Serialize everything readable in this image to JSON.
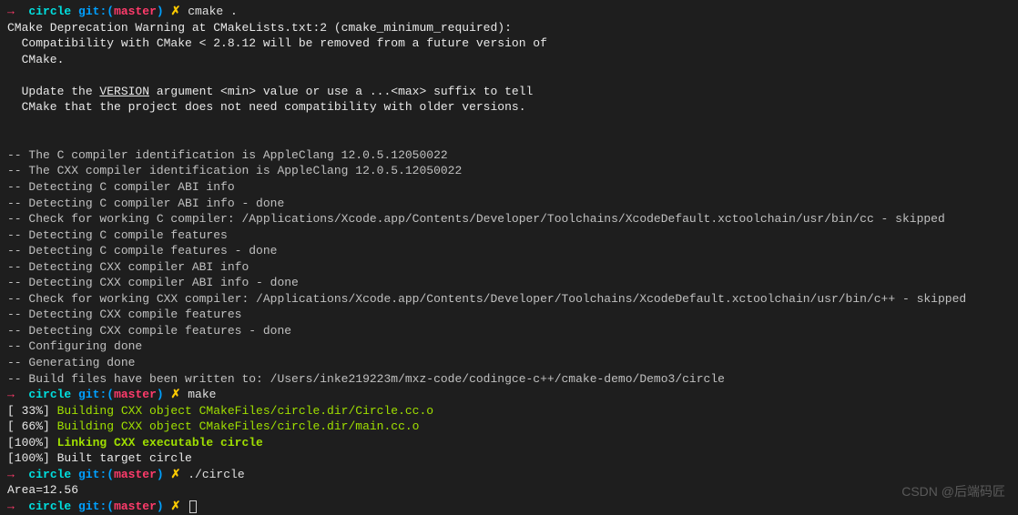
{
  "prompt": {
    "arrow": "→",
    "dir": "circle",
    "git_label": "git:(",
    "branch": "master",
    "close_paren": ")",
    "cross": "✗"
  },
  "commands": {
    "cmake": "cmake .",
    "make": "make",
    "run": "./circle",
    "empty": ""
  },
  "output": {
    "dep_warn_l1": "CMake Deprecation Warning at CMakeLists.txt:2 (cmake_minimum_required):",
    "dep_warn_l2": "  Compatibility with CMake < 2.8.12 will be removed from a future version of",
    "dep_warn_l3": "  CMake.",
    "dep_warn_l4": "  Update the ",
    "dep_warn_version": "VERSION",
    "dep_warn_l4b": " argument <min> value or use a ...<max> suffix to tell",
    "dep_warn_l5": "  CMake that the project does not need compatibility with older versions.",
    "blank": "",
    "c_id": "-- The C compiler identification is AppleClang 12.0.5.12050022",
    "cxx_id": "-- The CXX compiler identification is AppleClang 12.0.5.12050022",
    "det_c_abi": "-- Detecting C compiler ABI info",
    "det_c_abi_done": "-- Detecting C compiler ABI info - done",
    "check_c": "-- Check for working C compiler: /Applications/Xcode.app/Contents/Developer/Toolchains/XcodeDefault.xctoolchain/usr/bin/cc - skipped",
    "det_c_feat": "-- Detecting C compile features",
    "det_c_feat_done": "-- Detecting C compile features - done",
    "det_cxx_abi": "-- Detecting CXX compiler ABI info",
    "det_cxx_abi_done": "-- Detecting CXX compiler ABI info - done",
    "check_cxx": "-- Check for working CXX compiler: /Applications/Xcode.app/Contents/Developer/Toolchains/XcodeDefault.xctoolchain/usr/bin/c++ - skipped",
    "det_cxx_feat": "-- Detecting CXX compile features",
    "det_cxx_feat_done": "-- Detecting CXX compile features - done",
    "conf_done": "-- Configuring done",
    "gen_done": "-- Generating done",
    "build_written": "-- Build files have been written to: /Users/inke219223m/mxz-code/codingce-c++/cmake-demo/Demo3/circle",
    "make_33_pct": "[ 33%] ",
    "make_33_txt": "Building CXX object CMakeFiles/circle.dir/Circle.cc.o",
    "make_66_pct": "[ 66%] ",
    "make_66_txt": "Building CXX object CMakeFiles/circle.dir/main.cc.o",
    "make_100_pct": "[100%] ",
    "make_link": "Linking CXX executable circle",
    "make_built": "[100%] Built target circle",
    "run_output": "Area=12.56"
  },
  "watermark": "CSDN @后端码匠"
}
